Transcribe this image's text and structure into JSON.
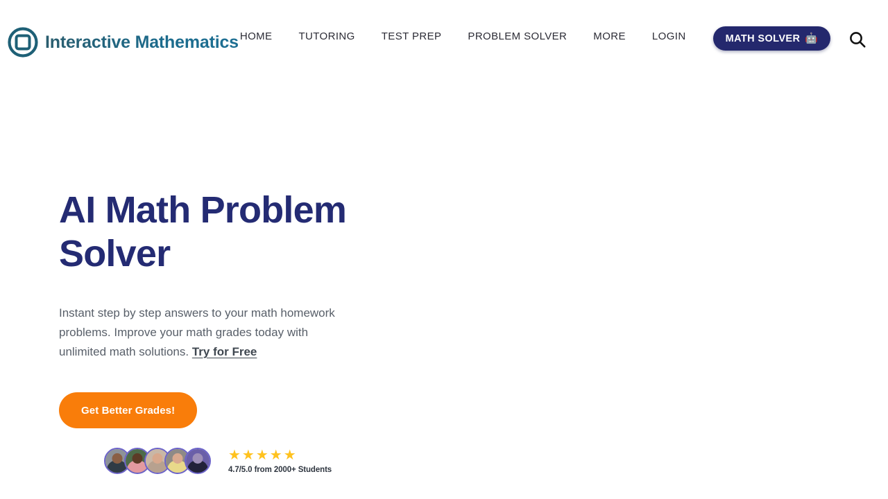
{
  "header": {
    "brand": {
      "name": "Interactive Mathematics",
      "logo_icon": "circle-square-logo-icon",
      "color": "#1e6076"
    },
    "nav_items": [
      {
        "label": "HOME"
      },
      {
        "label": "TUTORING"
      },
      {
        "label": "TEST PREP"
      },
      {
        "label": "PROBLEM SOLVER"
      },
      {
        "label": "MORE"
      },
      {
        "label": "LOGIN"
      }
    ],
    "math_solver_button": {
      "label": "MATH SOLVER",
      "emoji": "🤖",
      "background": "#24286d",
      "text_color": "#ffffff"
    },
    "search": {
      "icon": "search-icon"
    }
  },
  "hero": {
    "title": "AI Math Problem Solver",
    "title_color": "#242b73",
    "subtitle_prefix": "Instant step by step answers to your math homework problems. Improve your math grades today with unlimited math solutions. ",
    "subtitle_link": "Try for Free",
    "cta_label": "Get Better Grades!",
    "cta_color": "#f97d0a"
  },
  "social_proof": {
    "avatar_count": 5,
    "avatar_ring_color": "#6b62c9",
    "avatars": [
      {
        "name": "student-avatar-1",
        "bg": "#8d9298",
        "skin": "#8a5f44",
        "shirt": "#2f3b45"
      },
      {
        "name": "student-avatar-2",
        "bg": "#4d6b4a",
        "skin": "#5c3b26",
        "shirt": "#e39aa0"
      },
      {
        "name": "student-avatar-3",
        "bg": "#c9b7a6",
        "skin": "#d8a88d",
        "shirt": "#b7a18f"
      },
      {
        "name": "student-avatar-4",
        "bg": "#8e8a86",
        "skin": "#d9a98f",
        "shirt": "#e8d98a"
      },
      {
        "name": "student-avatar-5",
        "bg": "#6a5fa8",
        "skin": "#9e8fb8",
        "shirt": "#22223a"
      }
    ],
    "stars": "★★★★★",
    "star_color": "#ffc21e",
    "star_count": 5,
    "rating_text": "4.7/5.0 from 2000+ Students",
    "rating_value": "4.7",
    "rating_max": "5.0",
    "student_count": "2000+"
  }
}
